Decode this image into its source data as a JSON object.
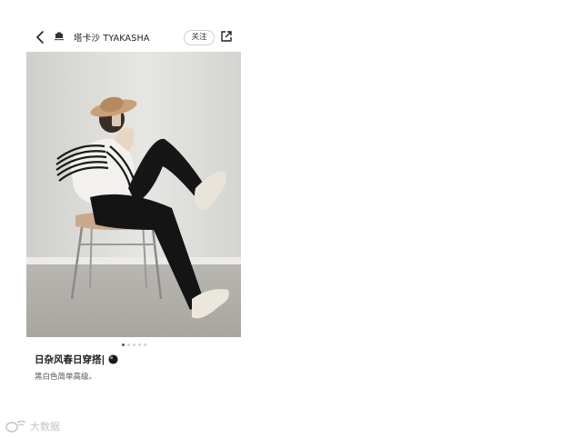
{
  "header": {
    "brand_name": "塔卡沙 TYAKASHA",
    "follow_label": "关注",
    "icons": {
      "back": "chevron-left-icon",
      "brand": "brand-logo-icon",
      "share": "share-icon"
    }
  },
  "photo": {
    "subject": "photo"
  },
  "carousel": {
    "count": 5,
    "active_index": 0
  },
  "post": {
    "title": "日杂风春日穿搭|",
    "title_icon": "black-ball-icon",
    "description": "黑白色简单高级。"
  },
  "watermark": {
    "text": "大数据"
  },
  "colors": {
    "text_primary": "#1e1e1e",
    "text_secondary": "#555555",
    "button_border": "#cfcfcf",
    "dot_inactive": "#d0d0d0",
    "dot_active": "#555555"
  }
}
